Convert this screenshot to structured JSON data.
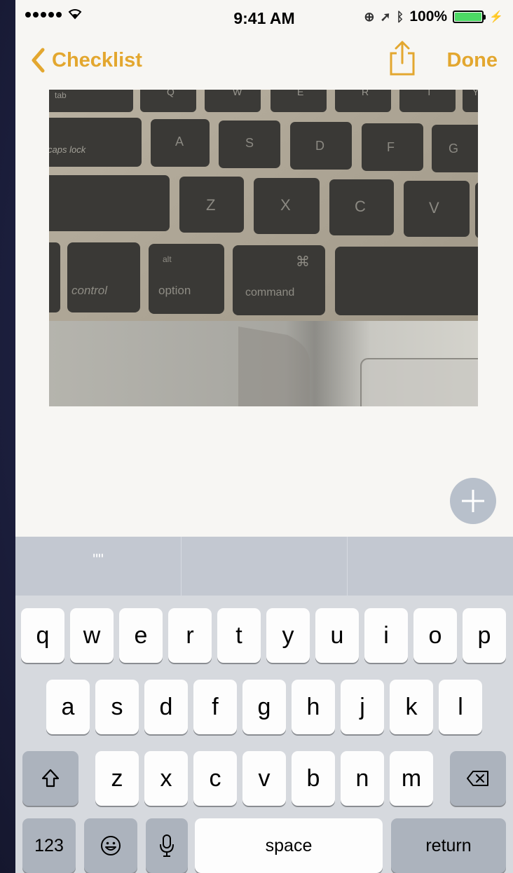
{
  "status_bar": {
    "time": "9:41 AM",
    "battery": "100%",
    "battery_level": 1.0
  },
  "nav": {
    "back_label": "Checklist",
    "done_label": "Done",
    "share_icon": "share-icon"
  },
  "note": {
    "image_keys": {
      "row_top": [
        "tab",
        "Q",
        "W",
        "E",
        "R",
        "T",
        "Y"
      ],
      "row_a": [
        "caps lock",
        "A",
        "S",
        "D",
        "F",
        "G"
      ],
      "row_z": [
        "Z",
        "X",
        "C",
        "V"
      ],
      "row_mod": {
        "control": "control",
        "alt": "alt",
        "option": "option",
        "cmd_symbol": "⌘",
        "command": "command"
      }
    }
  },
  "predictive": [
    "\"\"",
    "",
    ""
  ],
  "keyboard": {
    "row1": [
      "q",
      "w",
      "e",
      "r",
      "t",
      "y",
      "u",
      "i",
      "o",
      "p"
    ],
    "row2": [
      "a",
      "s",
      "d",
      "f",
      "g",
      "h",
      "j",
      "k",
      "l"
    ],
    "row3": [
      "z",
      "x",
      "c",
      "v",
      "b",
      "n",
      "m"
    ],
    "numbers_label": "123",
    "space_label": "space",
    "return_label": "return",
    "shift_icon": "shift-icon",
    "delete_icon": "delete-icon",
    "emoji_icon": "emoji-icon",
    "mic_icon": "microphone-icon"
  },
  "colors": {
    "accent": "#e3a72f",
    "plus_button": "#b8c0cb",
    "predictive_bar": "#c3c8d1",
    "keyboard_bg": "#d6d9de"
  }
}
